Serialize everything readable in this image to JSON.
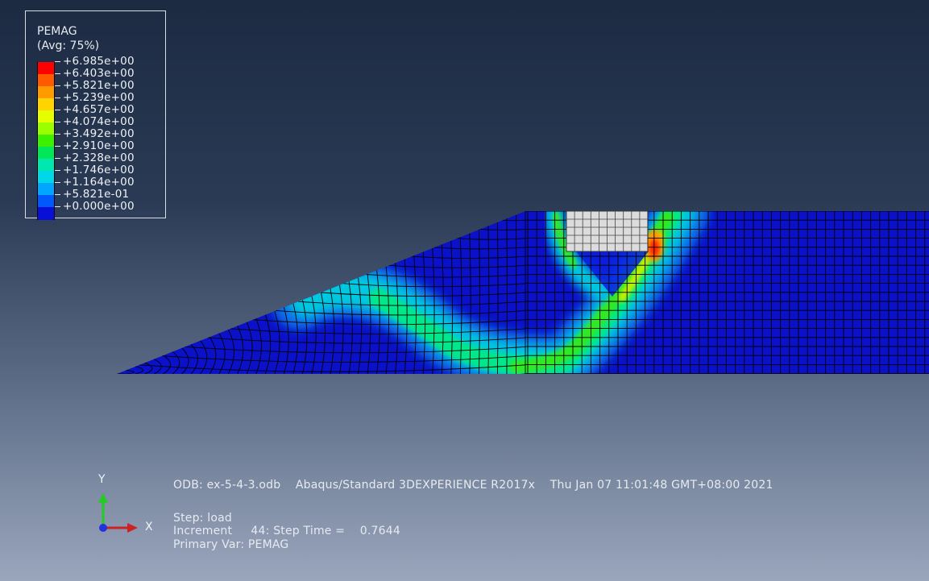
{
  "legend": {
    "title": "PEMAG",
    "subtitle": "(Avg: 75%)",
    "levels": [
      {
        "label": "+6.985e+00",
        "color": "#ff0000"
      },
      {
        "label": "+6.403e+00",
        "color": "#ff5a00"
      },
      {
        "label": "+5.821e+00",
        "color": "#ff9a00"
      },
      {
        "label": "+5.239e+00",
        "color": "#ffd400"
      },
      {
        "label": "+4.657e+00",
        "color": "#e6ff00"
      },
      {
        "label": "+4.074e+00",
        "color": "#9cff00"
      },
      {
        "label": "+3.492e+00",
        "color": "#3cf000"
      },
      {
        "label": "+2.910e+00",
        "color": "#00e85a"
      },
      {
        "label": "+2.328e+00",
        "color": "#00e8b0"
      },
      {
        "label": "+1.746e+00",
        "color": "#00d8e8"
      },
      {
        "label": "+1.164e+00",
        "color": "#00a6ff"
      },
      {
        "label": "+5.821e-01",
        "color": "#0058ff"
      },
      {
        "label": "+0.000e+00",
        "color": "#0a0fd8"
      }
    ]
  },
  "triad": {
    "y_label": "Y",
    "x_label": "X"
  },
  "info": {
    "odb_line": "ODB: ex-5-4-3.odb    Abaqus/Standard 3DEXPERIENCE R2017x    Thu Jan 07 11:01:48 GMT+08:00 2021",
    "step_line": "Step: load",
    "increment_line": "Increment     44: Step Time =    0.7644",
    "primary_var_line": "Primary Var: PEMAG"
  },
  "colors": {
    "base_mesh": "#0a11c8",
    "mesh_line": "#000000",
    "footing": "#dcdcdc"
  }
}
